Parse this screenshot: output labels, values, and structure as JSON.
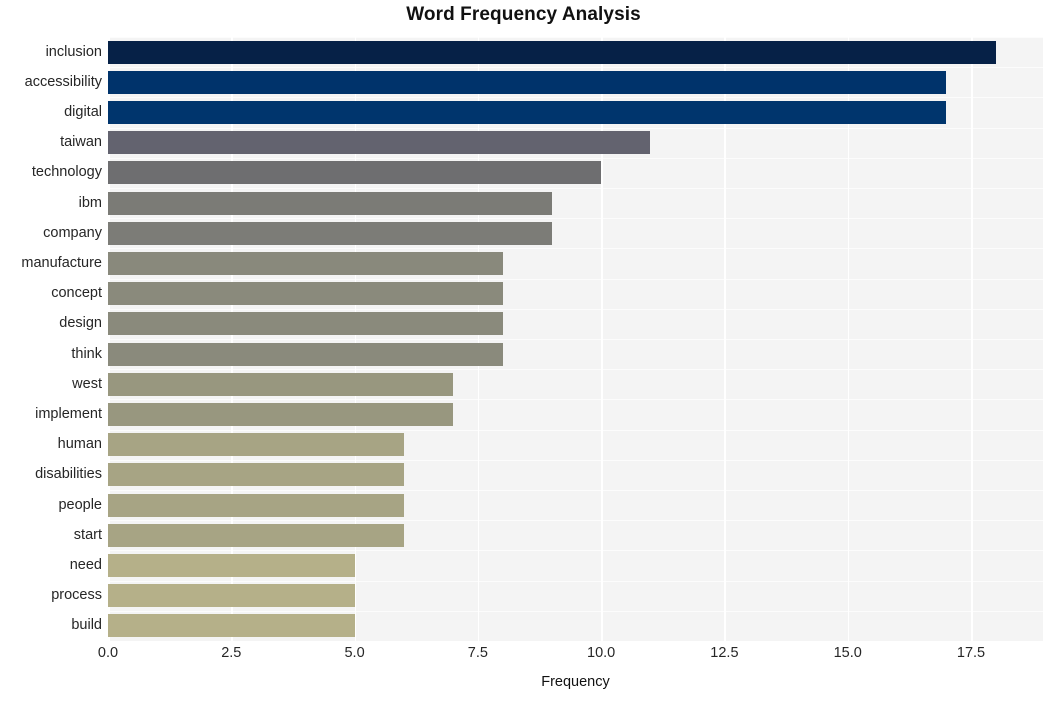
{
  "chart_data": {
    "type": "bar",
    "orientation": "horizontal",
    "title": "Word Frequency Analysis",
    "xlabel": "Frequency",
    "ylabel": "",
    "categories": [
      "inclusion",
      "accessibility",
      "digital",
      "taiwan",
      "technology",
      "ibm",
      "company",
      "manufacture",
      "concept",
      "design",
      "think",
      "west",
      "implement",
      "human",
      "disabilities",
      "people",
      "start",
      "need",
      "process",
      "build"
    ],
    "values": [
      18,
      17,
      17,
      11,
      10,
      9,
      9,
      8,
      8,
      8,
      8,
      7,
      7,
      6,
      6,
      6,
      6,
      5,
      5,
      5
    ],
    "bar_colors": [
      "#062147",
      "#00336b",
      "#00356d",
      "#63636f",
      "#6e6e70",
      "#7b7b76",
      "#7c7c77",
      "#89897c",
      "#8a8a7c",
      "#8a8a7c",
      "#8a8a7c",
      "#98977f",
      "#98977f",
      "#a7a484",
      "#a7a484",
      "#a7a484",
      "#a7a484",
      "#b5b089",
      "#b5b089",
      "#b5b089"
    ],
    "xlim": [
      0,
      18.96
    ],
    "ylim_count": 20,
    "xticks": [
      0,
      2.5,
      5,
      7.5,
      10,
      12.5,
      15,
      17.5
    ],
    "xticklabels": [
      "0.0",
      "2.5",
      "5.0",
      "7.5",
      "10.0",
      "12.5",
      "15.0",
      "17.5"
    ],
    "grid": "vertical-and-horizontal-white-on-light-gray",
    "legend": "none",
    "plot_background": "#f4f4f4",
    "figure_background": "#ffffff",
    "tick_label_color": "#262626",
    "title_color": "#111111"
  }
}
